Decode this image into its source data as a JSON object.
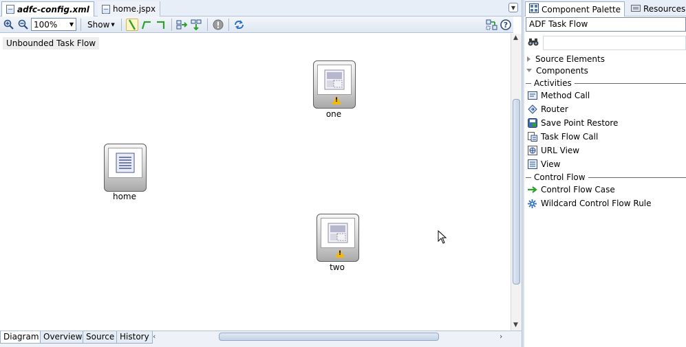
{
  "editor": {
    "tabs": [
      {
        "label": "adfc-config.xml",
        "active": true
      },
      {
        "label": "home.jspx",
        "active": false
      }
    ],
    "toolbar": {
      "zoom_value": "100%",
      "show_label": "Show"
    },
    "canvas": {
      "flow_label": "Unbounded Task Flow",
      "nodes": [
        {
          "name": "one",
          "warning": true
        },
        {
          "name": "home",
          "warning": false
        },
        {
          "name": "two",
          "warning": true
        }
      ]
    },
    "bottom_tabs": [
      "Diagram",
      "Overview",
      "Source",
      "History"
    ],
    "active_bottom_tab": "Diagram"
  },
  "palette": {
    "tabs": [
      {
        "label": "Component Palette",
        "active": true
      },
      {
        "label": "Resources",
        "active": false
      }
    ],
    "dropdown_value": "ADF Task Flow",
    "sections": {
      "source_elements": "Source Elements",
      "components": "Components"
    },
    "groups": {
      "activities": "Activities",
      "control_flow": "Control Flow"
    },
    "activities": [
      "Method Call",
      "Router",
      "Save Point Restore",
      "Task Flow Call",
      "URL View",
      "View"
    ],
    "control_flow": [
      "Control Flow Case",
      "Wildcard Control Flow Rule"
    ]
  },
  "colors": {
    "accent": "#2d4d82",
    "toolbar_bg": "#dfe7f2",
    "warning": "#f2b90c",
    "flow_arrow": "#2ea02e"
  },
  "icons": [
    "zoom-in-icon",
    "zoom-out-icon",
    "help-icon",
    "binoculars-icon",
    "warning-icon"
  ]
}
